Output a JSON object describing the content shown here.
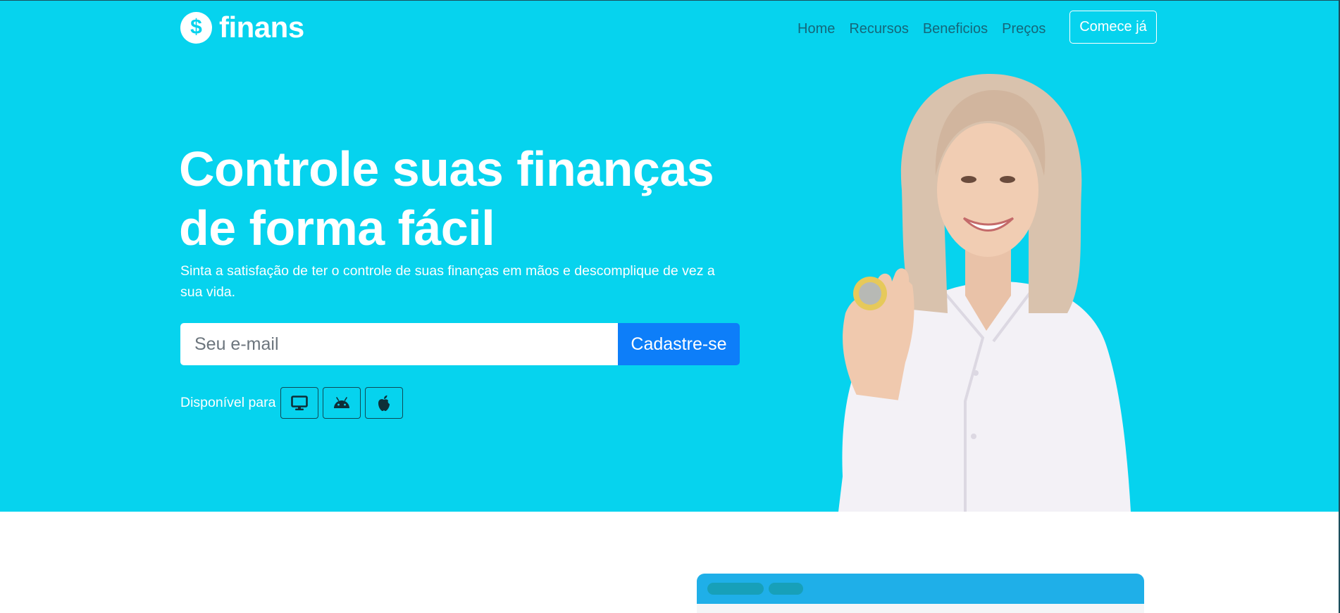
{
  "brand": {
    "icon": "dollar-icon",
    "icon_glyph": "$",
    "name": "finans"
  },
  "nav": {
    "items": [
      "Home",
      "Recursos",
      "Beneficios",
      "Preços"
    ],
    "cta": "Comece já"
  },
  "hero": {
    "headline_line1": "Controle suas finanças",
    "headline_line2": "de forma fácil",
    "subtitle": "Sinta a satisfação de ter o controle de suas finanças em mãos e descomplique de vez a sua vida.",
    "email_placeholder": "Seu e-mail",
    "signup_label": "Cadastre-se",
    "available_label": "Disponível para",
    "platforms": [
      "desktop-icon",
      "android-icon",
      "apple-icon"
    ]
  },
  "colors": {
    "hero_bg": "#06d3ee",
    "primary_button": "#0d7ef9",
    "preview_bar": "#1fafe8"
  }
}
